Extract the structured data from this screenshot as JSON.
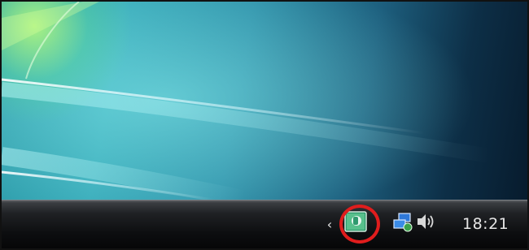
{
  "taskbar": {
    "show_hidden_icons_glyph": "‹",
    "clock": "18:21"
  },
  "tray_icons": [
    {
      "name": "app-tray-icon",
      "highlighted": true
    },
    {
      "name": "network-icon"
    },
    {
      "name": "volume-icon"
    }
  ],
  "colors": {
    "highlight_ring": "#e01d1d",
    "taskbar": "#1f2124",
    "wallpaper_accent": "#36a9b8"
  }
}
